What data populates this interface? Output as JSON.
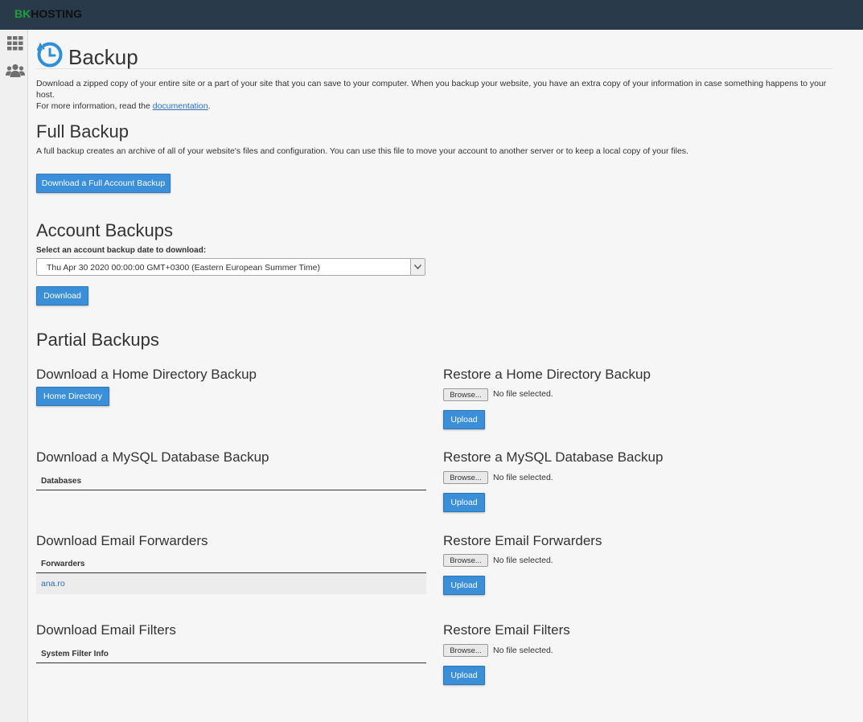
{
  "brand": {
    "part1": "BK",
    "part2": "HOSTING"
  },
  "page": {
    "title": "Backup",
    "intro_line1": "Download a zipped copy of your entire site or a part of your site that you can save to your computer. When you backup your website, you have an extra copy of your information in case something happens to your host.",
    "intro_line2_prefix": "For more information, read the ",
    "intro_link": "documentation",
    "intro_line2_suffix": "."
  },
  "full_backup": {
    "heading": "Full Backup",
    "description": "A full backup creates an archive of all of your website's files and configuration. You can use this file to move your account to another server or to keep a local copy of your files.",
    "button": "Download a Full Account Backup"
  },
  "account_backups": {
    "heading": "Account Backups",
    "select_label": "Select an account backup date to download:",
    "selected": "Thu Apr 30 2020 00:00:00 GMT+0300 (Eastern European Summer Time)",
    "button": "Download"
  },
  "partial": {
    "heading": "Partial Backups",
    "home_dl": {
      "heading": "Download a Home Directory Backup",
      "button": "Home Directory"
    },
    "home_restore": {
      "heading": "Restore a Home Directory Backup",
      "browse": "Browse...",
      "status": "No file selected.",
      "upload": "Upload"
    },
    "mysql_dl": {
      "heading": "Download a MySQL Database Backup",
      "column": "Databases"
    },
    "mysql_restore": {
      "heading": "Restore a MySQL Database Backup",
      "browse": "Browse...",
      "status": "No file selected.",
      "upload": "Upload"
    },
    "fwd_dl": {
      "heading": "Download Email Forwarders",
      "column": "Forwarders",
      "rows": [
        "ana.ro"
      ]
    },
    "fwd_restore": {
      "heading": "Restore Email Forwarders",
      "browse": "Browse...",
      "status": "No file selected.",
      "upload": "Upload"
    },
    "filters_dl": {
      "heading": "Download Email Filters",
      "column": "System Filter Info"
    },
    "filters_restore": {
      "heading": "Restore Email Filters",
      "browse": "Browse...",
      "status": "No file selected.",
      "upload": "Upload"
    }
  },
  "colors": {
    "topbar": "#293a4a",
    "button": "#3a8fd8",
    "brand_green": "#1f9d3a",
    "link": "#2a6ebb"
  },
  "icons": {
    "sidebar_1": "grid-icon",
    "sidebar_2": "users-icon",
    "page": "backup-clock-icon",
    "select": "chevron-down-icon"
  }
}
